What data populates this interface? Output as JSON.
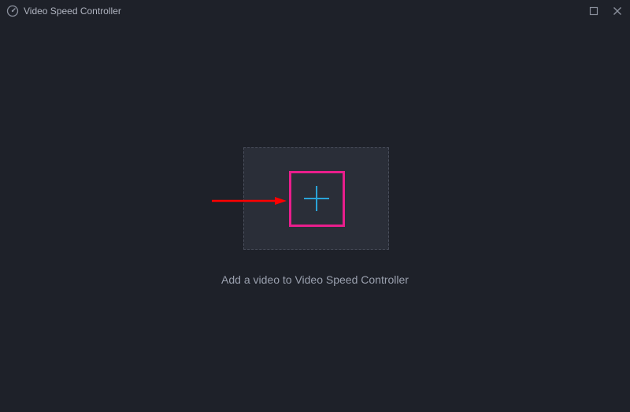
{
  "titlebar": {
    "app_title": "Video Speed Controller"
  },
  "main": {
    "hint_text": "Add a video to Video Speed Controller"
  },
  "icons": {
    "app": "speed-gauge-icon",
    "maximize": "maximize-icon",
    "close": "close-icon",
    "plus": "plus-icon"
  },
  "colors": {
    "background": "#1e2129",
    "dropzone_bg": "#2a2e38",
    "dropzone_border": "#4a4f5c",
    "text_muted": "#9aa0ae",
    "accent_plus": "#2aa3d8",
    "highlight": "#e91e8c",
    "arrow": "#ff0000"
  }
}
